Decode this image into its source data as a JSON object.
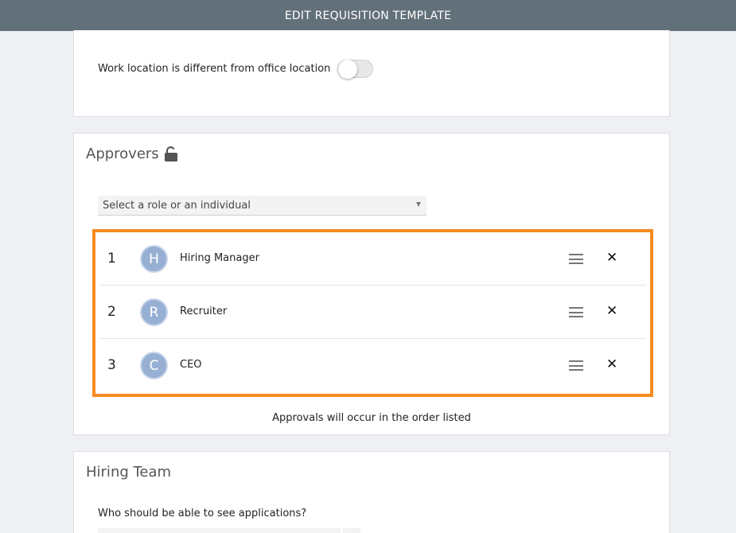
{
  "header": {
    "title": "EDIT REQUISITION TEMPLATE"
  },
  "location": {
    "toggle_label": "Work location is different from office location",
    "toggle_on": false
  },
  "approvers": {
    "title": "Approvers",
    "lock_icon": "lock-open-icon",
    "select_placeholder": "Select a role or an individual",
    "highlight_color": "#f68b1f",
    "avatar_color": "#97afd3",
    "items": [
      {
        "order": "1",
        "initial": "H",
        "name": "Hiring Manager"
      },
      {
        "order": "2",
        "initial": "R",
        "name": "Recruiter"
      },
      {
        "order": "3",
        "initial": "C",
        "name": "CEO"
      }
    ],
    "note": "Approvals will occur in the order listed"
  },
  "hiring_team": {
    "title": "Hiring Team",
    "question": "Who should be able to see applications?"
  },
  "icons": {
    "drag": "drag-handle-icon",
    "remove": "close-icon",
    "dropdown": "chevron-down-icon"
  },
  "colors": {
    "header_bg": "#627079",
    "page_bg": "#eef0f4"
  }
}
